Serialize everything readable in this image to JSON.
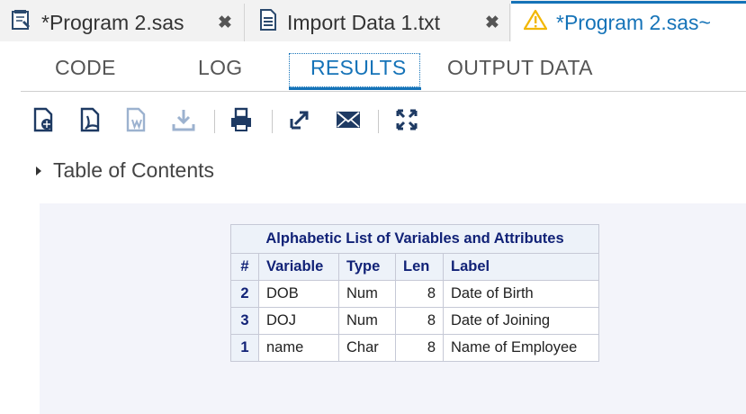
{
  "doc_tabs": [
    {
      "label": "*Program 2.sas",
      "icon": "program-icon",
      "close": "✖"
    },
    {
      "label": "Import Data 1.txt",
      "icon": "text-file-icon",
      "close": "✖"
    },
    {
      "label": "*Program 2.sas~",
      "icon": "warning-icon"
    }
  ],
  "sub_tabs": [
    "CODE",
    "LOG",
    "RESULTS",
    "OUTPUT DATA"
  ],
  "active_sub_tab": "RESULTS",
  "toolbar_icons": [
    "download-html-icon",
    "download-pdf-icon",
    "download-rtf-icon",
    "download-icon",
    "print-icon",
    "open-new-window-icon",
    "email-icon",
    "expand-icon"
  ],
  "toc_label": "Table of Contents",
  "table": {
    "caption": "Alphabetic List of Variables and Attributes",
    "headers": [
      "#",
      "Variable",
      "Type",
      "Len",
      "Label"
    ],
    "rows": [
      [
        "2",
        "DOB",
        "Num",
        "8",
        "Date of Birth"
      ],
      [
        "3",
        "DOJ",
        "Num",
        "8",
        "Date of Joining"
      ],
      [
        "1",
        "name",
        "Char",
        "8",
        "Name of Employee"
      ]
    ]
  },
  "colors": {
    "accent": "#1573b8",
    "header_text": "#112277",
    "header_bg": "#edf2f9",
    "panel_bg": "#f3f4fa",
    "warning": "#f2b705"
  }
}
